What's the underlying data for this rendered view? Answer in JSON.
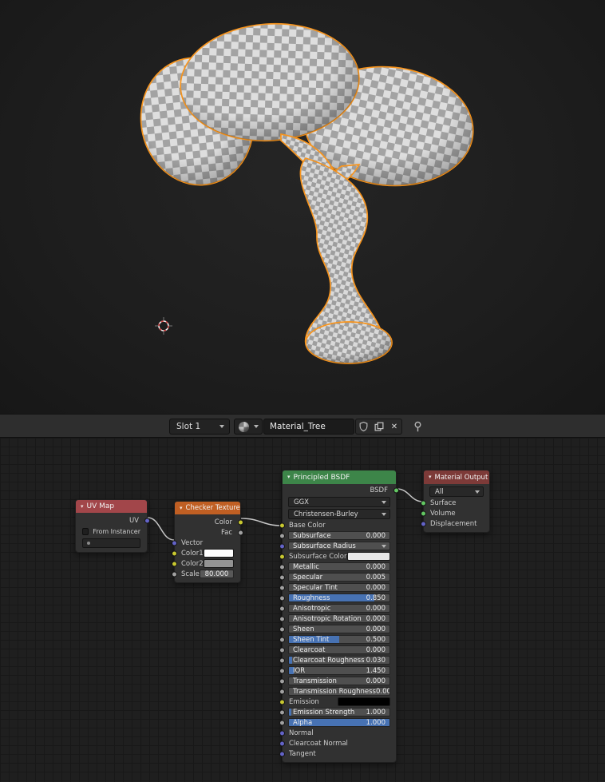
{
  "viewport": {
    "object": "tree-mesh-checker-textured",
    "outline_color": "#f7941d",
    "checker_light": "#e0e0e0",
    "checker_dark": "#a3a3a3"
  },
  "header": {
    "slot": "Slot 1",
    "material_name": "Material_Tree"
  },
  "nodes": {
    "uv_map": {
      "title": "UV Map",
      "output_label": "UV",
      "from_instancer_label": "From Instancer"
    },
    "checker": {
      "title": "Checker Texture",
      "out_color": "Color",
      "out_fac": "Fac",
      "in_vector": "Vector",
      "in_color1": "Color1",
      "in_color2": "Color2",
      "in_scale": "Scale",
      "scale_value": "80.000",
      "color1_hex": "#ffffff",
      "color2_hex": "#939393"
    },
    "principled": {
      "title": "Principled BSDF",
      "out_bsdf": "BSDF",
      "distribution": "GGX",
      "sss_method": "Christensen-Burley",
      "rows": [
        {
          "label": "Base Color",
          "type": "plain",
          "socket": "color"
        },
        {
          "label": "Subsurface",
          "type": "slider",
          "value": "0.000",
          "fill": 0,
          "socket": "value"
        },
        {
          "label": "Subsurface Radius",
          "type": "vector",
          "socket": "vector"
        },
        {
          "label": "Subsurface Color",
          "type": "color",
          "swatch": "#e8e8e8",
          "socket": "color"
        },
        {
          "label": "Metallic",
          "type": "slider",
          "value": "0.000",
          "fill": 0,
          "socket": "value"
        },
        {
          "label": "Specular",
          "type": "slider",
          "value": "0.005",
          "fill": 0,
          "socket": "value"
        },
        {
          "label": "Specular Tint",
          "type": "slider",
          "value": "0.000",
          "fill": 0,
          "socket": "value"
        },
        {
          "label": "Roughness",
          "type": "slider",
          "value": "0.850",
          "fill": 0.85,
          "socket": "value"
        },
        {
          "label": "Anisotropic",
          "type": "slider",
          "value": "0.000",
          "fill": 0,
          "socket": "value"
        },
        {
          "label": "Anisotropic Rotation",
          "type": "slider",
          "value": "0.000",
          "fill": 0,
          "socket": "value"
        },
        {
          "label": "Sheen",
          "type": "slider",
          "value": "0.000",
          "fill": 0,
          "socket": "value"
        },
        {
          "label": "Sheen Tint",
          "type": "slider",
          "value": "0.500",
          "fill": 0.5,
          "socket": "value"
        },
        {
          "label": "Clearcoat",
          "type": "slider",
          "value": "0.000",
          "fill": 0,
          "socket": "value"
        },
        {
          "label": "Clearcoat Roughness",
          "type": "slider",
          "value": "0.030",
          "fill": 0.03,
          "socket": "value"
        },
        {
          "label": "IOR",
          "type": "slider",
          "value": "1.450",
          "fill": 0.05,
          "socket": "value"
        },
        {
          "label": "Transmission",
          "type": "slider",
          "value": "0.000",
          "fill": 0,
          "socket": "value"
        },
        {
          "label": "Transmission Roughness",
          "type": "slider",
          "value": "0.000",
          "fill": 0,
          "socket": "value"
        },
        {
          "label": "Emission",
          "type": "color",
          "swatch": "#000000",
          "socket": "color"
        },
        {
          "label": "Emission Strength",
          "type": "slider",
          "value": "1.000",
          "fill": 0.02,
          "socket": "value"
        },
        {
          "label": "Alpha",
          "type": "slider",
          "value": "1.000",
          "fill": 1,
          "socket": "value"
        },
        {
          "label": "Normal",
          "type": "plain",
          "socket": "vector"
        },
        {
          "label": "Clearcoat Normal",
          "type": "plain",
          "socket": "vector"
        },
        {
          "label": "Tangent",
          "type": "plain",
          "socket": "vector"
        }
      ]
    },
    "output": {
      "title": "Material Output",
      "target": "All",
      "inputs": [
        {
          "label": "Surface",
          "socket": "shader"
        },
        {
          "label": "Volume",
          "socket": "shader"
        },
        {
          "label": "Displacement",
          "socket": "vector"
        }
      ]
    }
  },
  "colors": {
    "accent_blue": "#4772b3",
    "socket_value": "#a1a1a1",
    "socket_color": "#c8c830",
    "socket_vector": "#6363c7",
    "socket_shader": "#63c763",
    "header_uv": "#a2464a",
    "header_checker": "#c05f23",
    "header_principled": "#3d8549",
    "header_output": "#7d3a38"
  }
}
